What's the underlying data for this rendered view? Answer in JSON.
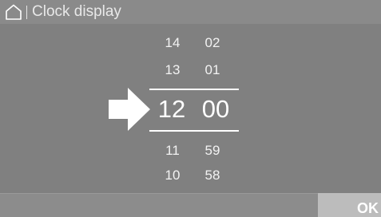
{
  "header": {
    "title": "Clock display",
    "home_icon": "home-icon"
  },
  "picker": {
    "hours": [
      "14",
      "13",
      "12",
      "11",
      "10"
    ],
    "minutes": [
      "02",
      "01",
      "00",
      "59",
      "58"
    ],
    "selected_hour": "12",
    "selected_minute": "00",
    "pointer_icon": "arrow-right-icon"
  },
  "footer": {
    "ok_label": "OK"
  },
  "colors": {
    "background": "#808080",
    "ok_button": "#bcbcbc",
    "text": "#ffffff"
  }
}
